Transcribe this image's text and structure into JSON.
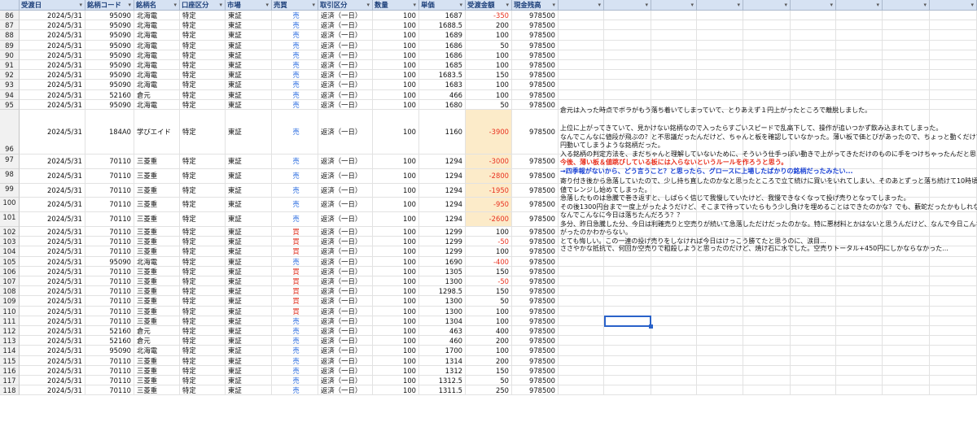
{
  "headers": [
    "受渡日",
    "銘柄コード",
    "銘柄名",
    "口座区分",
    "市場",
    "売買",
    "取引区分",
    "数量",
    "単価",
    "受渡金額",
    "現金残高"
  ],
  "colors": {
    "header_bg": "#d6e2f3",
    "header_text": "#1c3f7a",
    "negative": "#e8311f",
    "sell": "#2f6fe0",
    "buy": "#e0301f",
    "highlight": "#fcebc9",
    "selection": "#2a62c9"
  },
  "rows": [
    [
      "86",
      "2024/5/31",
      "95090",
      "北海電",
      "特定",
      "東証",
      "売",
      "返済（一日）",
      "100",
      "1687",
      "-350",
      "978500"
    ],
    [
      "87",
      "2024/5/31",
      "95090",
      "北海電",
      "特定",
      "東証",
      "売",
      "返済（一日）",
      "100",
      "1688.5",
      "200",
      "978500"
    ],
    [
      "88",
      "2024/5/31",
      "95090",
      "北海電",
      "特定",
      "東証",
      "売",
      "返済（一日）",
      "100",
      "1689",
      "100",
      "978500"
    ],
    [
      "89",
      "2024/5/31",
      "95090",
      "北海電",
      "特定",
      "東証",
      "売",
      "返済（一日）",
      "100",
      "1686",
      "50",
      "978500"
    ],
    [
      "90",
      "2024/5/31",
      "95090",
      "北海電",
      "特定",
      "東証",
      "売",
      "返済（一日）",
      "100",
      "1686",
      "100",
      "978500"
    ],
    [
      "91",
      "2024/5/31",
      "95090",
      "北海電",
      "特定",
      "東証",
      "売",
      "返済（一日）",
      "100",
      "1685",
      "100",
      "978500"
    ],
    [
      "92",
      "2024/5/31",
      "95090",
      "北海電",
      "特定",
      "東証",
      "売",
      "返済（一日）",
      "100",
      "1683.5",
      "150",
      "978500"
    ],
    [
      "93",
      "2024/5/31",
      "95090",
      "北海電",
      "特定",
      "東証",
      "売",
      "返済（一日）",
      "100",
      "1683",
      "100",
      "978500"
    ],
    [
      "94",
      "2024/5/31",
      "52160",
      "倉元",
      "特定",
      "東証",
      "売",
      "返済（一日）",
      "100",
      "466",
      "100",
      "978500"
    ],
    [
      "95",
      "2024/5/31",
      "95090",
      "北海電",
      "特定",
      "東証",
      "売",
      "返済（一日）",
      "100",
      "1680",
      "50",
      "978500"
    ],
    [
      "96",
      "2024/5/31",
      "184A0",
      "学びエイド",
      "特定",
      "東証",
      "売",
      "返済（一日）",
      "100",
      "1160",
      "-3900",
      "978500"
    ],
    [
      "97",
      "2024/5/31",
      "70110",
      "三菱重",
      "特定",
      "東証",
      "売",
      "返済（一日）",
      "100",
      "1294",
      "-3000",
      "978500"
    ],
    [
      "98",
      "2024/5/31",
      "70110",
      "三菱重",
      "特定",
      "東証",
      "売",
      "返済（一日）",
      "100",
      "1294",
      "-2800",
      "978500"
    ],
    [
      "99",
      "2024/5/31",
      "70110",
      "三菱重",
      "特定",
      "東証",
      "売",
      "返済（一日）",
      "100",
      "1294",
      "-1950",
      "978500"
    ],
    [
      "100",
      "2024/5/31",
      "70110",
      "三菱重",
      "特定",
      "東証",
      "売",
      "返済（一日）",
      "100",
      "1294",
      "-950",
      "978500"
    ],
    [
      "101",
      "2024/5/31",
      "70110",
      "三菱重",
      "特定",
      "東証",
      "売",
      "返済（一日）",
      "100",
      "1294",
      "-2600",
      "978500"
    ],
    [
      "102",
      "2024/5/31",
      "70110",
      "三菱重",
      "特定",
      "東証",
      "買",
      "返済（一日）",
      "100",
      "1299",
      "100",
      "978500"
    ],
    [
      "103",
      "2024/5/31",
      "70110",
      "三菱重",
      "特定",
      "東証",
      "買",
      "返済（一日）",
      "100",
      "1299",
      "-50",
      "978500"
    ],
    [
      "104",
      "2024/5/31",
      "70110",
      "三菱重",
      "特定",
      "東証",
      "買",
      "返済（一日）",
      "100",
      "1299",
      "100",
      "978500"
    ],
    [
      "105",
      "2024/5/31",
      "95090",
      "北海電",
      "特定",
      "東証",
      "売",
      "返済（一日）",
      "100",
      "1690",
      "-400",
      "978500"
    ],
    [
      "106",
      "2024/5/31",
      "70110",
      "三菱重",
      "特定",
      "東証",
      "買",
      "返済（一日）",
      "100",
      "1305",
      "150",
      "978500"
    ],
    [
      "107",
      "2024/5/31",
      "70110",
      "三菱重",
      "特定",
      "東証",
      "買",
      "返済（一日）",
      "100",
      "1300",
      "-50",
      "978500"
    ],
    [
      "108",
      "2024/5/31",
      "70110",
      "三菱重",
      "特定",
      "東証",
      "買",
      "返済（一日）",
      "100",
      "1298.5",
      "150",
      "978500"
    ],
    [
      "109",
      "2024/5/31",
      "70110",
      "三菱重",
      "特定",
      "東証",
      "買",
      "返済（一日）",
      "100",
      "1300",
      "50",
      "978500"
    ],
    [
      "110",
      "2024/5/31",
      "70110",
      "三菱重",
      "特定",
      "東証",
      "買",
      "返済（一日）",
      "100",
      "1300",
      "100",
      "978500"
    ],
    [
      "111",
      "2024/5/31",
      "70110",
      "三菱重",
      "特定",
      "東証",
      "売",
      "返済（一日）",
      "100",
      "1304",
      "100",
      "978500"
    ],
    [
      "112",
      "2024/5/31",
      "52160",
      "倉元",
      "特定",
      "東証",
      "売",
      "返済（一日）",
      "100",
      "463",
      "400",
      "978500"
    ],
    [
      "113",
      "2024/5/31",
      "52160",
      "倉元",
      "特定",
      "東証",
      "売",
      "返済（一日）",
      "100",
      "460",
      "200",
      "978500"
    ],
    [
      "114",
      "2024/5/31",
      "95090",
      "北海電",
      "特定",
      "東証",
      "売",
      "返済（一日）",
      "100",
      "1700",
      "100",
      "978500"
    ],
    [
      "115",
      "2024/5/31",
      "70110",
      "三菱重",
      "特定",
      "東証",
      "売",
      "返済（一日）",
      "100",
      "1314",
      "200",
      "978500"
    ],
    [
      "116",
      "2024/5/31",
      "70110",
      "三菱重",
      "特定",
      "東証",
      "売",
      "返済（一日）",
      "100",
      "1312",
      "150",
      "978500"
    ],
    [
      "117",
      "2024/5/31",
      "70110",
      "三菱重",
      "特定",
      "東証",
      "売",
      "返済（一日）",
      "100",
      "1312.5",
      "50",
      "978500"
    ],
    [
      "118",
      "2024/5/31",
      "70110",
      "三菱重",
      "特定",
      "東証",
      "売",
      "返済（一日）",
      "100",
      "1311.5",
      "250",
      "978500"
    ]
  ],
  "notes": [
    {
      "text": "倉元は入った時点でボラがもう落ち着いてしまっていて、とりあえず１円上がったところで離脱しました。",
      "style": "normal"
    },
    {
      "text": "上位に上がってきていて、見かけない銘柄なので入ったらすごいスピードで乱高下して、操作が追いつかず飲み込まれてしまった。",
      "style": "normal"
    },
    {
      "text": "なんでこんなに値段が飛ぶの？と不思議だったんだけど、ちゃんと板を確認していなかった。薄い板で価とびがあったので、ちょっと動くだけで数十",
      "style": "normal"
    },
    {
      "text": "円動いてしまうような銘柄だった。",
      "style": "normal"
    },
    {
      "text": "入る銘柄の判定方法を、まだちゃんと理解していないために、そういう仕手っぽい動きで上がってきただけのものに手をつけちゃったんだと思う。",
      "style": "normal"
    },
    {
      "text": "今後、薄い板＆値跳びしている板には入らないというルールを作ろうと思う。",
      "style": "red"
    },
    {
      "text": "→四季報がないから、どう言うこと？と思ったら、グロースに上場したばかりの銘柄だったみたい...",
      "style": "blue"
    },
    {
      "text": "寄り付き後から急落していたので、少し持ち直したのかなと思ったところで立て続けに買いをいれてしまい、そのあとずっと落ち続けて10時頃には底",
      "style": "normal"
    },
    {
      "text": "値でレンジし始めてしまった。",
      "style": "normal"
    },
    {
      "text": "急落したものは急騰で巻き返すと、しばらく信じて我慢していたけど、我慢できなくなって投げ売りとなってしまった。",
      "style": "normal"
    },
    {
      "text": "その後1300円台まで一度上がったようだけど、そこまで待っていたらもう少し負けを埋めることはできたのかな？でも、藪蛇だったかもしれないし。",
      "style": "normal"
    },
    {
      "text": "なんでこんなに今日は落ちたんだろう？？",
      "style": "normal"
    },
    {
      "text": "多分、昨日急騰した分、今日は利確売りと空売りが続いて急落しただけだったのかな。特に悪材料とかはないと思うんだけど、なんで今日こんなに下",
      "style": "normal"
    },
    {
      "text": "がったのかわからない。",
      "style": "normal"
    },
    {
      "text": "とても悔しい。この一連の投げ売りをしなければ今日はけっこう勝てたと思うのに、涙目...",
      "style": "normal"
    },
    {
      "text": "ささやかな抵抗で、何回か空売りで粗殺しようと思ったのだけど、焼け石に水でした。空売りトータル+450円にしかならなかった...",
      "style": "normal"
    }
  ],
  "header_dropdown_glyph": "▾"
}
